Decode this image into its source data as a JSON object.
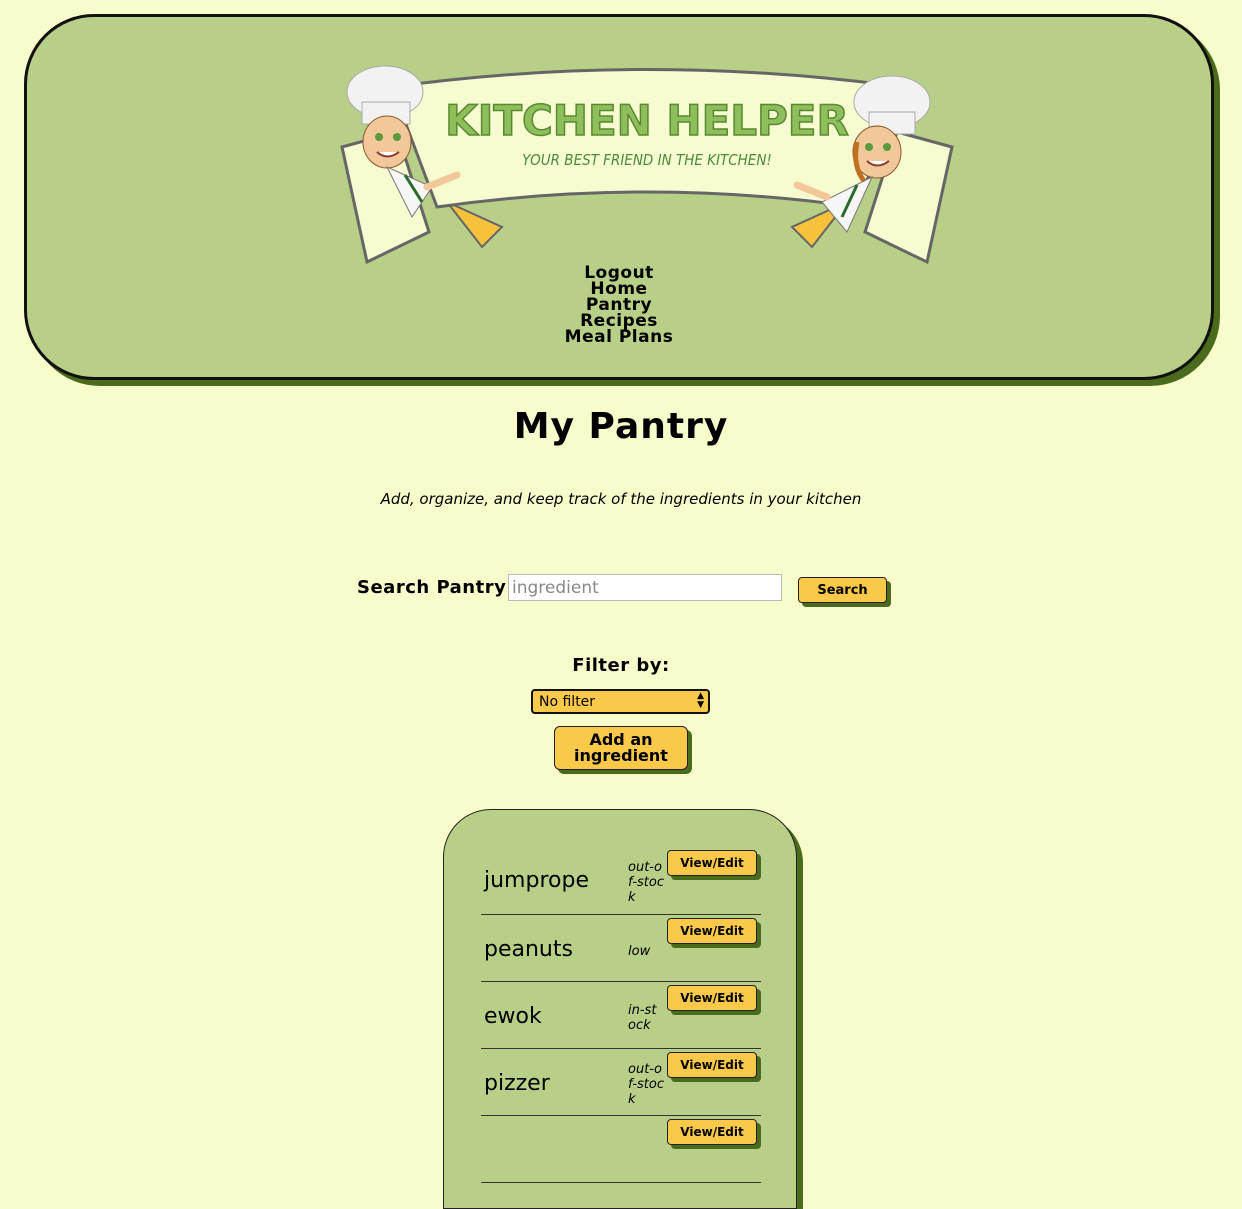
{
  "logo": {
    "title": "KITCHEN HELPER",
    "tagline": "YOUR BEST FRIEND IN THE KITCHEN!"
  },
  "nav": {
    "items": [
      "Logout",
      "Home",
      "Pantry",
      "Recipes",
      "Meal Plans"
    ]
  },
  "page": {
    "title": "My Pantry",
    "subtitle": "Add, organize, and keep track of the ingredients in your kitchen"
  },
  "search": {
    "label": "Search Pantry",
    "placeholder": "ingredient",
    "button": "Search"
  },
  "filter": {
    "label": "Filter by:",
    "selected": "No filter"
  },
  "add_button": "Add an ingredient",
  "pantry": {
    "items": [
      {
        "name": "jumprope",
        "status": "out-of-stock",
        "action": "View/Edit"
      },
      {
        "name": "peanuts",
        "status": "low",
        "action": "View/Edit"
      },
      {
        "name": "ewok",
        "status": "in-stock",
        "action": "View/Edit"
      },
      {
        "name": "pizzer",
        "status": "out-of-stock",
        "action": "View/Edit"
      },
      {
        "name": "",
        "status": "",
        "action": "View/Edit"
      }
    ]
  },
  "colors": {
    "background": "#f8fccb",
    "panel": "#b8cf88",
    "button": "#fbc94a",
    "shadow": "#4a6a1d"
  }
}
